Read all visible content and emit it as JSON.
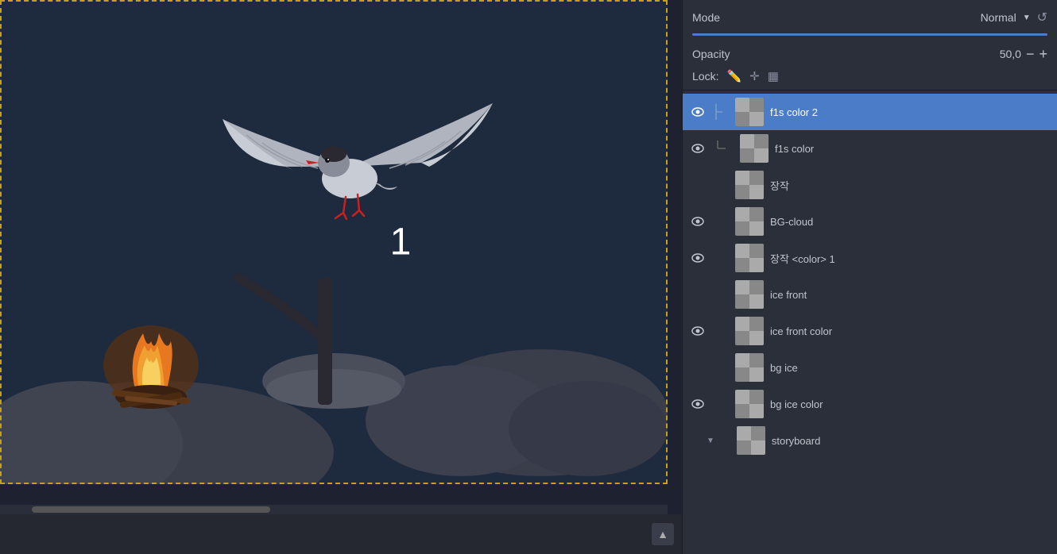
{
  "canvas": {
    "number": "1"
  },
  "panel": {
    "mode_label": "Mode",
    "mode_value": "Normal",
    "opacity_label": "Opacity",
    "opacity_value": "50,0",
    "lock_label": "Lock:"
  },
  "layers": [
    {
      "id": "f1s-color-2",
      "name": "f1s color 2",
      "visible": true,
      "selected": true,
      "indent": "none"
    },
    {
      "id": "f1s-color",
      "name": "f1s color",
      "visible": true,
      "selected": false,
      "indent": "sub"
    },
    {
      "id": "jangchak",
      "name": "장작",
      "visible": false,
      "selected": false,
      "indent": "none"
    },
    {
      "id": "bg-cloud",
      "name": "BG-cloud",
      "visible": true,
      "selected": false,
      "indent": "none"
    },
    {
      "id": "jangchak-color-1",
      "name": "장작 <color> 1",
      "visible": true,
      "selected": false,
      "indent": "none"
    },
    {
      "id": "ice-front",
      "name": "ice front",
      "visible": false,
      "selected": false,
      "indent": "none"
    },
    {
      "id": "ice-front-color",
      "name": "ice front color",
      "visible": true,
      "selected": false,
      "indent": "none"
    },
    {
      "id": "bg-ice",
      "name": "bg ice",
      "visible": false,
      "selected": false,
      "indent": "none"
    },
    {
      "id": "bg-ice-color",
      "name": "bg ice color",
      "visible": true,
      "selected": false,
      "indent": "none"
    },
    {
      "id": "storyboard",
      "name": "storyboard",
      "visible": false,
      "selected": false,
      "indent": "none",
      "collapsed": true
    }
  ]
}
